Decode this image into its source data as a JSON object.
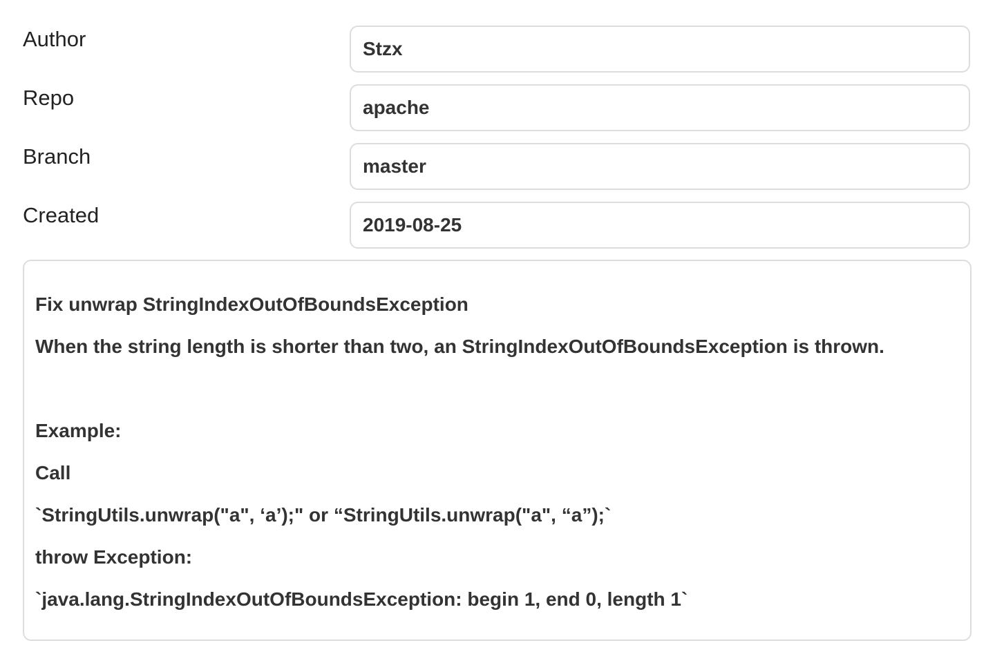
{
  "fields": [
    {
      "label": "Author",
      "value": "Stzx"
    },
    {
      "label": "Repo",
      "value": "apache"
    },
    {
      "label": "Branch",
      "value": "master"
    },
    {
      "label": "Created",
      "value": "2019-08-25"
    }
  ],
  "message": {
    "title": "Fix unwrap StringIndexOutOfBoundsException",
    "description": "When the string length is shorter than two, an StringIndexOutOfBoundsException is thrown.",
    "example_label": "Example:",
    "call_label": "Call",
    "call_code": "`StringUtils.unwrap(\"a\", ‘a’);\" or “StringUtils.unwrap(\"a\", “a”);`",
    "throw_label": "throw Exception:",
    "exception_code": "`java.lang.StringIndexOutOfBoundsException: begin 1, end 0, length 1`"
  }
}
